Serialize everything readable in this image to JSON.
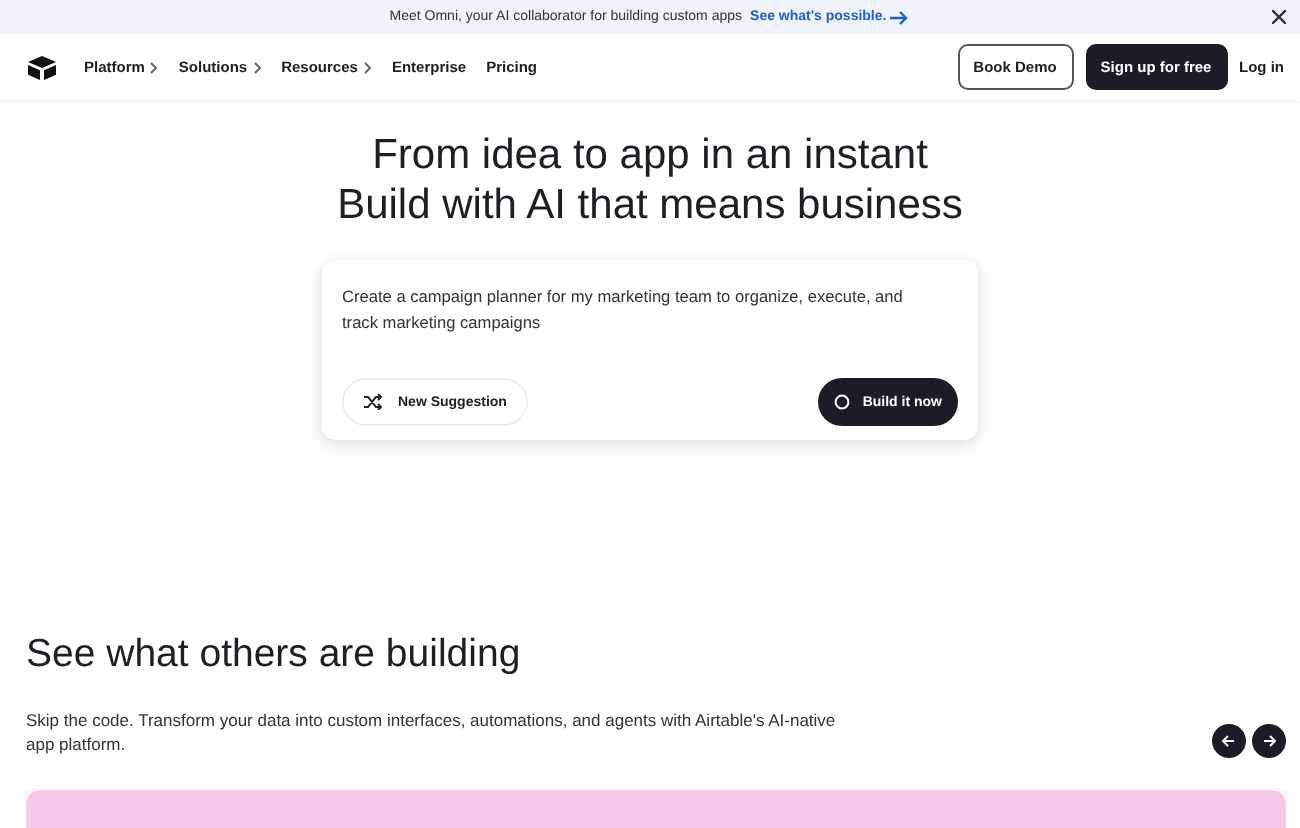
{
  "banner": {
    "text": "Meet Omni, your AI collaborator for building custom apps",
    "link": "See what's possible."
  },
  "nav": {
    "items": [
      {
        "label": "Platform",
        "expandable": true
      },
      {
        "label": "Solutions",
        "expandable": true
      },
      {
        "label": "Resources",
        "expandable": true
      },
      {
        "label": "Enterprise",
        "expandable": false
      },
      {
        "label": "Pricing",
        "expandable": false
      }
    ],
    "book_demo": "Book Demo",
    "sign_up": "Sign up for free",
    "log_in": "Log in"
  },
  "hero": {
    "title_lines": [
      "From idea to app in an instant",
      "Build with AI that means business"
    ],
    "prompt": "Create a campaign planner for my marketing team to organize, execute, and track marketing campaigns",
    "suggestion_button": "New Suggestion",
    "build_button": "Build it now"
  },
  "showcase": {
    "heading": "See what others are building",
    "description": "Skip the code. Transform your data into custom interfaces, automations, and agents with Airtable's AI-native app platform."
  }
}
